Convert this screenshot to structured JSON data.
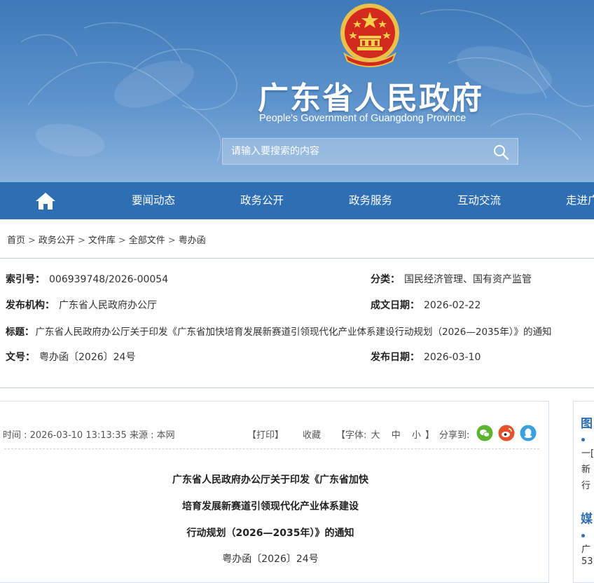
{
  "header": {
    "title": "广东省人民政府",
    "subtitle": "People's Government of Guangdong Province"
  },
  "search": {
    "placeholder": "请输入要搜索的内容"
  },
  "nav": {
    "items": [
      "要闻动态",
      "政务公开",
      "政务服务",
      "互动交流",
      "走进广"
    ]
  },
  "breadcrumb": [
    "首页",
    "政务公开",
    "文件库",
    "全部文件",
    "粤办函"
  ],
  "meta": {
    "index_label": "索引号：",
    "index_value": "006939748/2026-00054",
    "category_label": "分类：",
    "category_value": "国民经济管理、国有资产监管",
    "publisher_label": "发布机构：",
    "publisher_value": "广东省人民政府办公厅",
    "written_date_label": "成文日期：",
    "written_date_value": "2026-02-22",
    "title_label": "标题：",
    "title_value": "广东省人民政府办公厅关于印发《广东省加快培育发展新赛道引领现代化产业体系建设行动规划（2026—2035年）》的通知",
    "doc_no_label": "文号：",
    "doc_no_value": "粤办函〔2026〕24号",
    "publish_date_label": "发布日期：",
    "publish_date_value": "2026-03-10"
  },
  "article": {
    "time": "时间 : 2026-03-10 13:13:35",
    "source": "来源 : 本网",
    "print": "【打印】",
    "favorite": "收藏",
    "font_prefix": "【字体:",
    "font_large": "大",
    "font_medium": "中",
    "font_small": "小",
    "font_suffix": "】",
    "share_label": "分享到:",
    "title_lines": [
      "广东省人民政府办公厅关于印发《广东省加快",
      "培育发展新赛道引领现代化产业体系建设",
      "行动规划（2026—2035年）》的通知"
    ],
    "doc_no": "粤办函〔2026〕24号"
  },
  "side": {
    "title1": "图",
    "lines1": [
      "一[",
      "新",
      "行"
    ],
    "title2": "媒",
    "lines2": [
      "广",
      "53"
    ]
  },
  "colors": {
    "nav_bg": "#2e6fb4",
    "banner_top": "#3d79b8",
    "banner_bottom": "#8ab3dd",
    "wechat": "#5cb531",
    "weibo": "#e5512c",
    "qq": "#3aa0e0"
  },
  "icons": [
    "national-emblem-icon",
    "search-icon",
    "home-icon",
    "wechat-icon",
    "weibo-icon",
    "qq-icon"
  ]
}
